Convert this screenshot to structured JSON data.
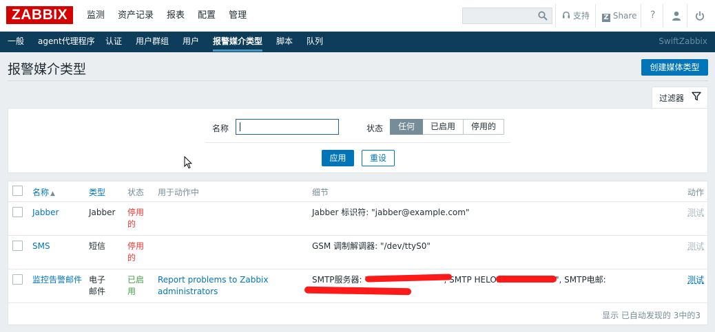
{
  "app": {
    "logo": "ZABBIX",
    "main_menu": [
      "监测",
      "资产记录",
      "报表",
      "配置",
      "管理"
    ],
    "search": {
      "value": "",
      "placeholder": ""
    },
    "support_label": "支持",
    "share_label": "Share",
    "help_label": "?",
    "brand_colors": {
      "logo": "#d40000",
      "subbar": "#0e3d5b",
      "accent": "#0275b8"
    }
  },
  "submenu": {
    "items": [
      "一般",
      "agent代理程序",
      "认证",
      "用户群组",
      "用户",
      "报警媒介类型",
      "脚本",
      "队列"
    ],
    "active": "报警媒介类型",
    "brand": "SwiftZabbix"
  },
  "page": {
    "title": "报警媒介类型",
    "create_button": "创建媒体类型"
  },
  "filter": {
    "tab_label": "过滤器",
    "name_label": "名称",
    "name_value": "",
    "status_label": "状态",
    "status_options": [
      "任何",
      "已启用",
      "停用的"
    ],
    "status_selected": "任何",
    "apply_button": "应用",
    "reset_button": "重设"
  },
  "table": {
    "headers": {
      "name": "名称",
      "sort_indicator": "▲",
      "type": "类型",
      "status": "状态",
      "used_in_actions": "用于动作中",
      "details": "细节",
      "action": "动作"
    },
    "rows": [
      {
        "name": "Jabber",
        "type": "Jabber",
        "status": "停用的",
        "status_kind": "disabled",
        "actions": "",
        "details": "Jabber 标识符: \"jabber@example.com\"",
        "test": "测试"
      },
      {
        "name": "SMS",
        "type": "短信",
        "status": "停用的",
        "status_kind": "disabled",
        "actions": "",
        "details": "GSM 调制解调器: \"/dev/ttyS0\"",
        "test": "测试"
      },
      {
        "name": "监控告警邮件",
        "type": "电子邮件",
        "status": "已启用",
        "status_kind": "enabled",
        "actions": "Report problems to Zabbix administrators",
        "details": "SMTP服务器: \"",
        "details_mid": "\", SMTP HELO: \"",
        "details_end": "\", SMTP电邮:",
        "test": "测试"
      }
    ],
    "footer": "显示 已自动发现的 3中的3"
  }
}
